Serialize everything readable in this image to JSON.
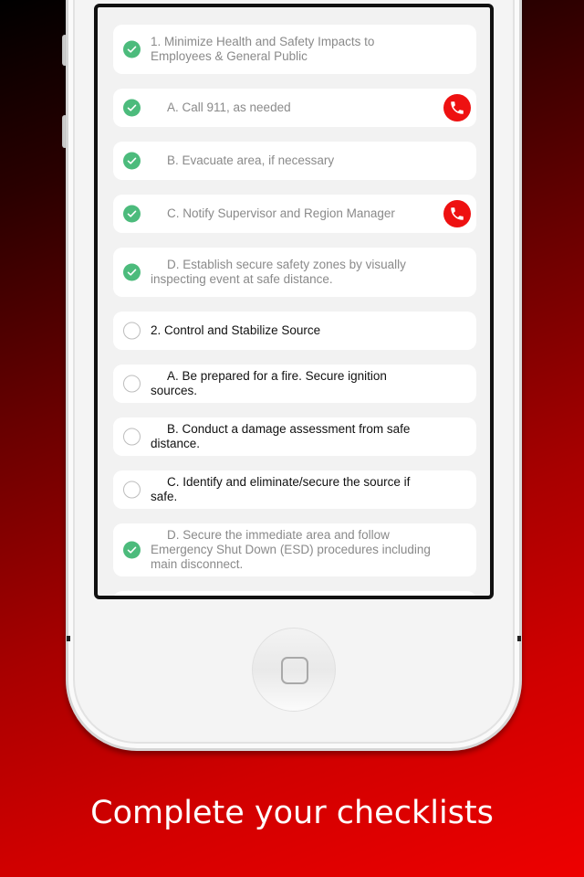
{
  "caption": "Complete your checklists",
  "colors": {
    "check_done": "#4cbb7c",
    "call_button": "#ee1111",
    "background_accent": "#ee0000"
  },
  "checklist": [
    {
      "text": "1. Minimize Health and Safety Impacts to Employees & General Public",
      "checked": true,
      "call": false,
      "level": "section"
    },
    {
      "text": "A. Call 911, as needed",
      "checked": true,
      "call": true,
      "level": "sub"
    },
    {
      "text": "B. Evacuate area, if necessary",
      "checked": true,
      "call": false,
      "level": "sub"
    },
    {
      "text": "C. Notify Supervisor and Region Manager",
      "checked": true,
      "call": true,
      "level": "sub"
    },
    {
      "text": "D. Establish secure safety zones by visually inspecting event at safe distance.",
      "checked": true,
      "call": false,
      "level": "sub"
    },
    {
      "text": "2. Control and Stabilize Source",
      "checked": false,
      "call": false,
      "level": "section"
    },
    {
      "text": "A. Be prepared for a fire. Secure ignition sources.",
      "checked": false,
      "call": false,
      "level": "sub"
    },
    {
      "text": "B. Conduct a damage assessment from safe distance.",
      "checked": false,
      "call": false,
      "level": "sub"
    },
    {
      "text": "C. Identify and eliminate/secure the source if safe.",
      "checked": false,
      "call": false,
      "level": "sub"
    },
    {
      "text": "D. Secure the immediate area and follow Emergency Shut Down (ESD) procedures including main disconnect.",
      "checked": true,
      "call": false,
      "level": "sub"
    }
  ]
}
